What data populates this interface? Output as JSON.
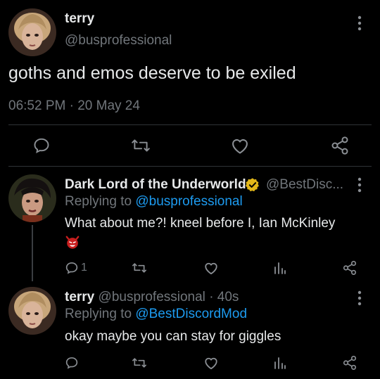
{
  "main_tweet": {
    "display_name": "terry",
    "handle": "@busprofessional",
    "text": "goths and emos deserve to be exiled",
    "timestamp": "06:52 PM · 20 May 24",
    "avatar_icon": "avatar-terry-icon",
    "more_icon": "more-vertical-icon"
  },
  "main_actions": [
    "reply-icon",
    "retweet-icon",
    "like-icon",
    "share-icon"
  ],
  "reply_1": {
    "display_name": "Dark Lord of the Underworld",
    "handle": "@BestDisc...",
    "replying_prefix": "Replying to",
    "replying_to": "@busprofessional",
    "text": "What about me?! kneel before I, Ian McKinley",
    "emoji_icon": "devil-face-emoji-icon",
    "verified_icon": "verified-badge-icon",
    "reply_count": "1"
  },
  "reply_2": {
    "display_name": "terry",
    "handle": "@busprofessional",
    "time": "· 40s",
    "replying_prefix": "Replying to",
    "replying_to": "@BestDiscordMod",
    "text": "okay maybe you can stay for giggles"
  },
  "reply_actions": [
    "reply-icon",
    "retweet-icon",
    "like-icon",
    "views-icon",
    "share-icon"
  ],
  "colors": {
    "background": "#000000",
    "text": "#e7e9ea",
    "muted": "#71767b",
    "link": "#1d9bf0",
    "verified_gold": "#e2b719",
    "divider": "#2f3336"
  }
}
